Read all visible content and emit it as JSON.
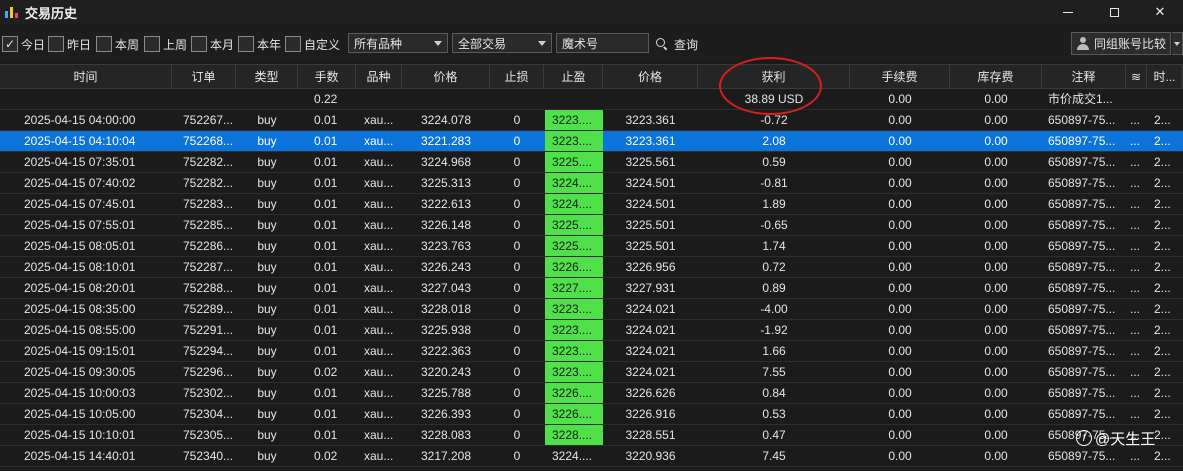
{
  "window": {
    "title": "交易历史",
    "minimize": "—",
    "maximize": "",
    "close": "✕"
  },
  "filters": {
    "checks": [
      {
        "label": "今日",
        "checked": true
      },
      {
        "label": "昨日",
        "checked": false
      },
      {
        "label": "本周",
        "checked": false
      },
      {
        "label": "上周",
        "checked": false
      },
      {
        "label": "本月",
        "checked": false
      },
      {
        "label": "本年",
        "checked": false
      },
      {
        "label": "自定义",
        "checked": false
      }
    ],
    "symbol_select": "所有品种",
    "trade_select": "全部交易",
    "magic_placeholder": "魔术号",
    "query_label": "查询",
    "compare_label": "同组账号比较"
  },
  "table": {
    "headers": [
      "时间",
      "订单",
      "类型",
      "手数",
      "品种",
      "价格",
      "止损",
      "止盈",
      "价格",
      "获利",
      "手续费",
      "库存费",
      "注释",
      "≋",
      "时..."
    ],
    "summary": {
      "lots": "0.22",
      "profit": "38.89 USD",
      "fee": "0.00",
      "swap": "0.00",
      "comment": "市价成交1..."
    },
    "rows": [
      [
        "2025-04-15 04:00:00",
        "752267...",
        "buy",
        "0.01",
        "xau...",
        "3224.078",
        "0",
        "3223....",
        "3223.361",
        "-0.72",
        "0.00",
        "0.00",
        "650897-75...",
        "...",
        "2..."
      ],
      [
        "2025-04-15 04:10:04",
        "752268...",
        "buy",
        "0.01",
        "xau...",
        "3221.283",
        "0",
        "3223....",
        "3223.361",
        "2.08",
        "0.00",
        "0.00",
        "650897-75...",
        "...",
        "2..."
      ],
      [
        "2025-04-15 07:35:01",
        "752282...",
        "buy",
        "0.01",
        "xau...",
        "3224.968",
        "0",
        "3225....",
        "3225.561",
        "0.59",
        "0.00",
        "0.00",
        "650897-75...",
        "...",
        "2..."
      ],
      [
        "2025-04-15 07:40:02",
        "752282...",
        "buy",
        "0.01",
        "xau...",
        "3225.313",
        "0",
        "3224....",
        "3224.501",
        "-0.81",
        "0.00",
        "0.00",
        "650897-75...",
        "...",
        "2..."
      ],
      [
        "2025-04-15 07:45:01",
        "752283...",
        "buy",
        "0.01",
        "xau...",
        "3222.613",
        "0",
        "3224....",
        "3224.501",
        "1.89",
        "0.00",
        "0.00",
        "650897-75...",
        "...",
        "2..."
      ],
      [
        "2025-04-15 07:55:01",
        "752285...",
        "buy",
        "0.01",
        "xau...",
        "3226.148",
        "0",
        "3225....",
        "3225.501",
        "-0.65",
        "0.00",
        "0.00",
        "650897-75...",
        "...",
        "2..."
      ],
      [
        "2025-04-15 08:05:01",
        "752286...",
        "buy",
        "0.01",
        "xau...",
        "3223.763",
        "0",
        "3225....",
        "3225.501",
        "1.74",
        "0.00",
        "0.00",
        "650897-75...",
        "...",
        "2..."
      ],
      [
        "2025-04-15 08:10:01",
        "752287...",
        "buy",
        "0.01",
        "xau...",
        "3226.243",
        "0",
        "3226....",
        "3226.956",
        "0.72",
        "0.00",
        "0.00",
        "650897-75...",
        "...",
        "2..."
      ],
      [
        "2025-04-15 08:20:01",
        "752288...",
        "buy",
        "0.01",
        "xau...",
        "3227.043",
        "0",
        "3227....",
        "3227.931",
        "0.89",
        "0.00",
        "0.00",
        "650897-75...",
        "...",
        "2..."
      ],
      [
        "2025-04-15 08:35:00",
        "752289...",
        "buy",
        "0.01",
        "xau...",
        "3228.018",
        "0",
        "3223....",
        "3224.021",
        "-4.00",
        "0.00",
        "0.00",
        "650897-75...",
        "...",
        "2..."
      ],
      [
        "2025-04-15 08:55:00",
        "752291...",
        "buy",
        "0.01",
        "xau...",
        "3225.938",
        "0",
        "3223....",
        "3224.021",
        "-1.92",
        "0.00",
        "0.00",
        "650897-75...",
        "...",
        "2..."
      ],
      [
        "2025-04-15 09:15:01",
        "752294...",
        "buy",
        "0.01",
        "xau...",
        "3222.363",
        "0",
        "3223....",
        "3224.021",
        "1.66",
        "0.00",
        "0.00",
        "650897-75...",
        "...",
        "2..."
      ],
      [
        "2025-04-15 09:30:05",
        "752296...",
        "buy",
        "0.02",
        "xau...",
        "3220.243",
        "0",
        "3223....",
        "3224.021",
        "7.55",
        "0.00",
        "0.00",
        "650897-75...",
        "...",
        "2..."
      ],
      [
        "2025-04-15 10:00:03",
        "752302...",
        "buy",
        "0.01",
        "xau...",
        "3225.788",
        "0",
        "3226....",
        "3226.626",
        "0.84",
        "0.00",
        "0.00",
        "650897-75...",
        "...",
        "2..."
      ],
      [
        "2025-04-15 10:05:00",
        "752304...",
        "buy",
        "0.01",
        "xau...",
        "3226.393",
        "0",
        "3226....",
        "3226.916",
        "0.53",
        "0.00",
        "0.00",
        "650897-75...",
        "...",
        "2..."
      ],
      [
        "2025-04-15 10:10:01",
        "752305...",
        "buy",
        "0.01",
        "xau...",
        "3228.083",
        "0",
        "3228....",
        "3228.551",
        "0.47",
        "0.00",
        "0.00",
        "650897-75...",
        "...",
        "2..."
      ],
      [
        "2025-04-15 14:40:01",
        "752340...",
        "buy",
        "0.02",
        "xau...",
        "3217.208",
        "0",
        "3224....",
        "3220.936",
        "7.45",
        "0.00",
        "0.00",
        "650897-75...",
        "...",
        "2..."
      ]
    ],
    "selected_row": 1,
    "green_tp_rows": [
      0,
      1,
      2,
      3,
      4,
      5,
      6,
      7,
      8,
      9,
      10,
      11,
      12,
      13,
      14,
      15
    ]
  },
  "colors": {
    "accent": "#0a74da",
    "tp_highlight": "#4fe04a",
    "annotation": "#d92020"
  },
  "watermark": {
    "text": "@天生王",
    "logo": "f"
  }
}
